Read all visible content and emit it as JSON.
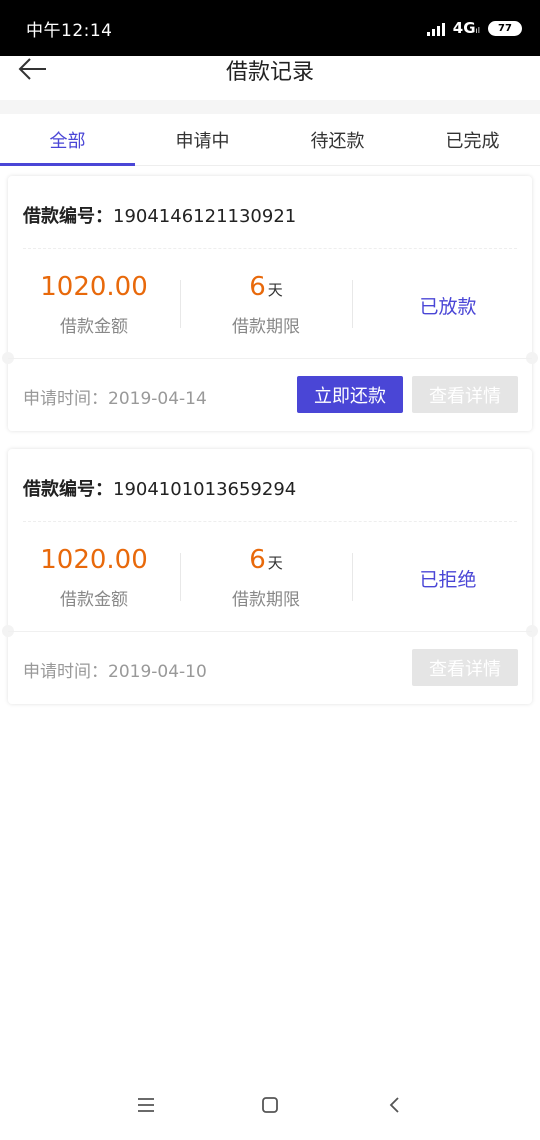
{
  "status_bar": {
    "time": "中午12:14",
    "network": "4G",
    "battery": "77"
  },
  "header": {
    "title": "借款记录",
    "back_icon": "arrow-left-icon"
  },
  "tabs": [
    {
      "label": "全部",
      "active": true
    },
    {
      "label": "申请中",
      "active": false
    },
    {
      "label": "待还款",
      "active": false
    },
    {
      "label": "已完成",
      "active": false
    }
  ],
  "records": [
    {
      "loan_no_label": "借款编号：",
      "loan_no": "1904146121130921",
      "amount": "1020.00",
      "amount_label": "借款金额",
      "term": "6",
      "term_unit": "天",
      "term_label": "借款期限",
      "status": "已放款",
      "apply_time": "申请时间：2019-04-14",
      "repay_label": "立即还款",
      "detail_label": "查看详情"
    },
    {
      "loan_no_label": "借款编号：",
      "loan_no": "1904101013659294",
      "amount": "1020.00",
      "amount_label": "借款金额",
      "term": "6",
      "term_unit": "天",
      "term_label": "借款期限",
      "status": "已拒绝",
      "apply_time": "申请时间：2019-04-10",
      "detail_label": "查看详情"
    }
  ],
  "colors": {
    "accent": "#4a46d6",
    "amount": "#e8690b",
    "disabled": "#e5e5e5"
  },
  "system_nav": [
    "menu-icon",
    "home-icon",
    "back-icon"
  ]
}
